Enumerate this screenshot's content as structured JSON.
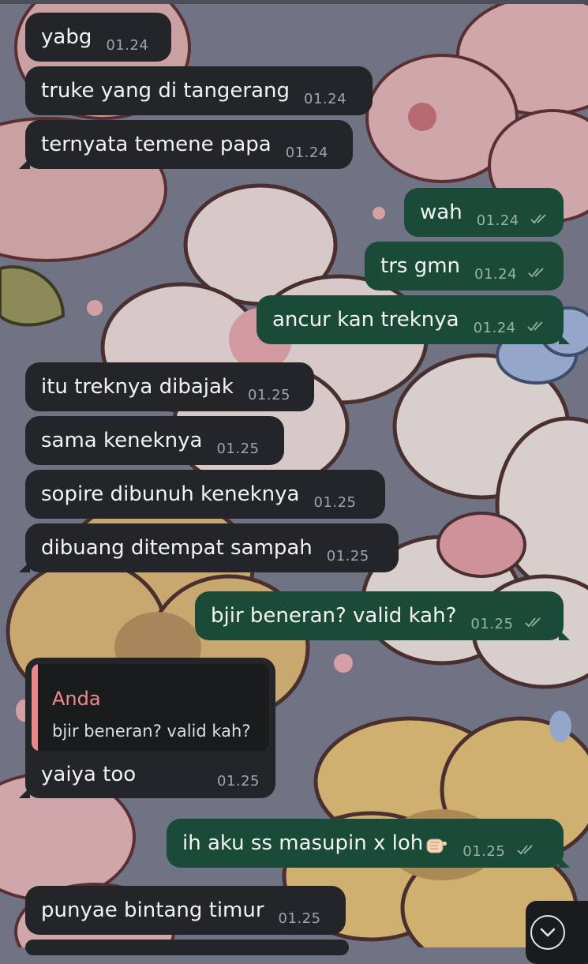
{
  "messages": [
    {
      "id": "m1",
      "dir": "in",
      "text": "yabg",
      "time": "01.24"
    },
    {
      "id": "m2",
      "dir": "in",
      "text": "truke yang di tangerang",
      "time": "01.24"
    },
    {
      "id": "m3",
      "dir": "in",
      "text": "ternyata temene papa",
      "time": "01.24"
    },
    {
      "id": "m4",
      "dir": "out",
      "text": "wah",
      "time": "01.24"
    },
    {
      "id": "m5",
      "dir": "out",
      "text": "trs gmn",
      "time": "01.24"
    },
    {
      "id": "m6",
      "dir": "out",
      "text": "ancur kan treknya",
      "time": "01.24"
    },
    {
      "id": "m7",
      "dir": "in",
      "text": "itu treknya dibajak",
      "time": "01.25"
    },
    {
      "id": "m8",
      "dir": "in",
      "text": "sama keneknya",
      "time": "01.25"
    },
    {
      "id": "m9",
      "dir": "in",
      "text": "sopire dibunuh keneknya",
      "time": "01.25"
    },
    {
      "id": "m10",
      "dir": "in",
      "text": "dibuang ditempat sampah",
      "time": "01.25"
    },
    {
      "id": "m11",
      "dir": "out",
      "text": "bjir beneran? valid kah?",
      "time": "01.25"
    },
    {
      "id": "m12",
      "dir": "in",
      "text": "yaiya too",
      "time": "01.25",
      "reply": {
        "name": "Anda",
        "text": "bjir beneran? valid kah?"
      }
    },
    {
      "id": "m13",
      "dir": "out",
      "text": "ih aku ss masupin x loh",
      "time": "01.25",
      "emoji": "pointing-hand-emoji"
    },
    {
      "id": "m14",
      "dir": "in",
      "text": "punyae bintang timur",
      "time": "01.25"
    }
  ],
  "icons": {
    "read_receipt": "double-check-icon",
    "scroll_down": "chevron-down-icon"
  },
  "colors": {
    "incoming_bubble": "#242528",
    "outgoing_bubble": "#1a4b38",
    "quote_accent": "#ef8a8f",
    "wallpaper_base": "#6f7384"
  }
}
